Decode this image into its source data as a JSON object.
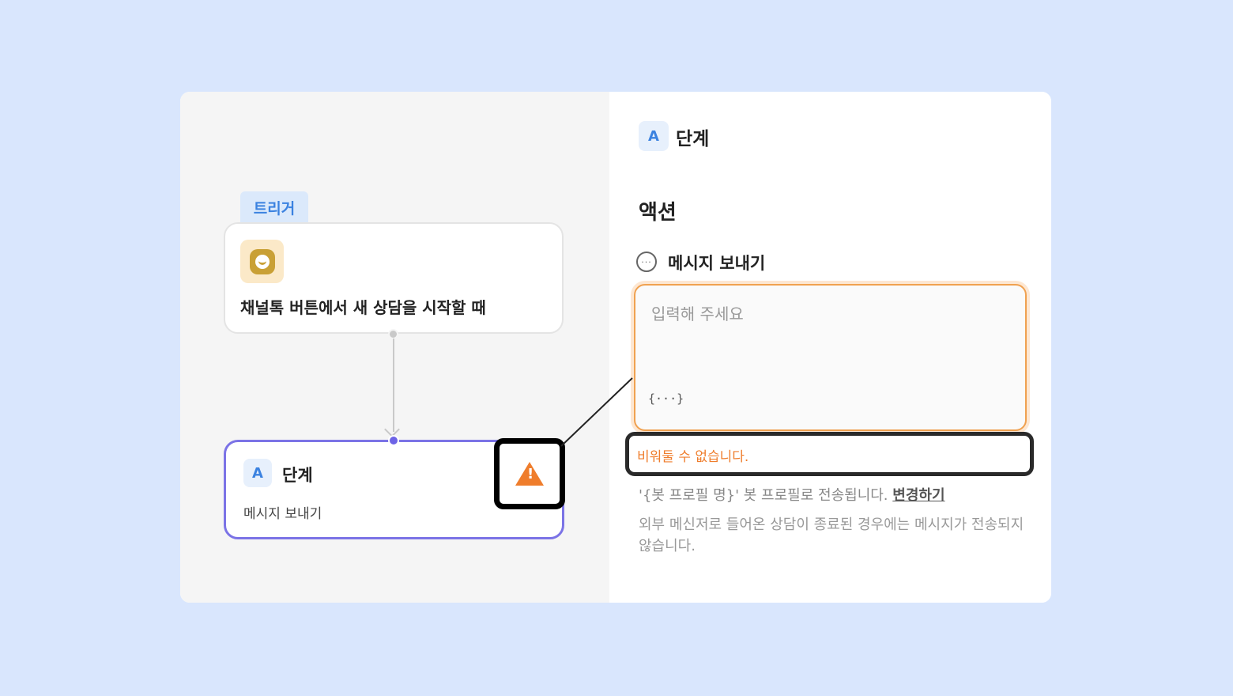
{
  "canvas": {
    "trigger_tag": "트리거",
    "trigger_node": {
      "title": "채널톡 버튼에서 새 상담을 시작할 때",
      "icon": "channel-talk-icon"
    },
    "step_node": {
      "badge": "A",
      "title": "단계",
      "subtitle": "메시지 보내기",
      "warning_icon": "warning-icon"
    }
  },
  "panel": {
    "header": {
      "badge": "A",
      "title": "단계"
    },
    "section_title": "액션",
    "action": {
      "title": "메시지 보내기",
      "icon": "chat-bubble-icon"
    },
    "input": {
      "placeholder": "입력해 주세요",
      "value": "",
      "variable_button": "{···}"
    },
    "error": "비워둘 수 없습니다.",
    "profile": {
      "text": "'{봇 프로필 명}' 봇 프로필로 전송됩니다. ",
      "link": "변경하기"
    },
    "note": "외부 메신저로 들어온 상담이 종료된 경우에는 메시지가 전송되지 않습니다."
  },
  "colors": {
    "accent": "#3b82e0",
    "step_border": "#7b73e6",
    "warning": "#ef7d2c",
    "background": "#d9e6fd"
  }
}
